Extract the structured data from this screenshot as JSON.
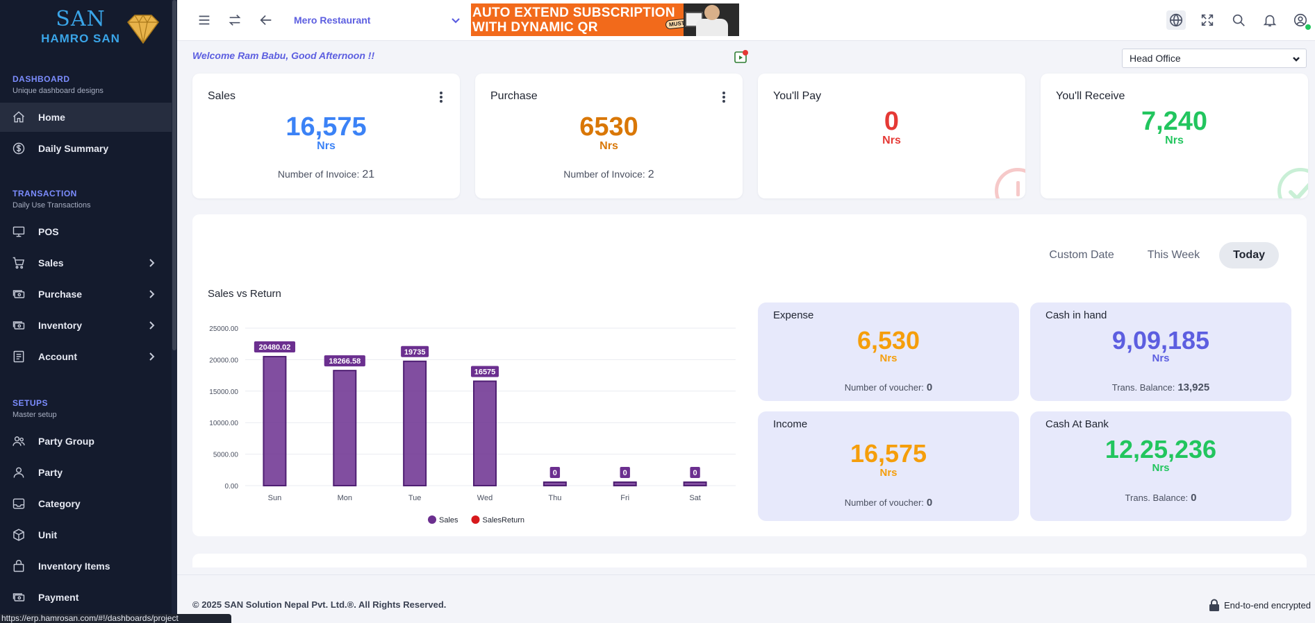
{
  "brand": {
    "logo_top": "SAN",
    "logo_bottom": "HAMRO SAN"
  },
  "sidebar": {
    "sections": [
      {
        "title": "DASHBOARD",
        "subtitle": "Unique dashboard designs"
      },
      {
        "title": "TRANSACTION",
        "subtitle": "Daily Use Transactions"
      },
      {
        "title": "SETUPS",
        "subtitle": "Master setup"
      }
    ],
    "items": [
      {
        "label": "Home",
        "icon": "home-icon",
        "active": true
      },
      {
        "label": "Daily Summary",
        "icon": "dollar-circle-icon"
      },
      {
        "label": "POS",
        "icon": "monitor-icon"
      },
      {
        "label": "Sales",
        "icon": "cart-icon",
        "expandable": true
      },
      {
        "label": "Purchase",
        "icon": "cash-icon",
        "expandable": true
      },
      {
        "label": "Inventory",
        "icon": "cash-icon",
        "expandable": true
      },
      {
        "label": "Account",
        "icon": "ledger-icon",
        "expandable": true
      },
      {
        "label": "Party Group",
        "icon": "users-icon"
      },
      {
        "label": "Party",
        "icon": "user-icon"
      },
      {
        "label": "Category",
        "icon": "inbox-icon"
      },
      {
        "label": "Unit",
        "icon": "cube-icon"
      },
      {
        "label": "Inventory Items",
        "icon": "bag-icon"
      },
      {
        "label": "Payment",
        "icon": "cash-icon"
      }
    ]
  },
  "topbar": {
    "restaurant": "Mero Restaurant",
    "banner_line1": "AUTO EXTEND SUBSCRIPTION",
    "banner_line2": "WITH DYNAMIC QR",
    "banner_badge": "MUST TRY",
    "icons": [
      "menu-icon",
      "swap-icon",
      "back-arrow-icon",
      "globe-icon",
      "fullscreen-icon",
      "search-icon",
      "bell-icon",
      "user-circle-icon"
    ]
  },
  "welcome": "Welcome Ram Babu, Good Afternoon !!",
  "branch": {
    "selected": "Head Office"
  },
  "cards": [
    {
      "title": "Sales",
      "amount": "16,575",
      "unit": "Nrs",
      "meta_label": "Number of Invoice:",
      "meta_value": "21",
      "color": "#3b82f6"
    },
    {
      "title": "Purchase",
      "amount": "6530",
      "unit": "Nrs",
      "meta_label": "Number of Invoice:",
      "meta_value": "2",
      "color": "#d97706"
    },
    {
      "title": "You'll Pay",
      "amount": "0",
      "unit": "Nrs",
      "color": "#e53935"
    },
    {
      "title": "You'll Receive",
      "amount": "7,240",
      "unit": "Nrs",
      "color": "#22c55e"
    }
  ],
  "date_tabs": [
    {
      "label": "Custom Date",
      "active": false
    },
    {
      "label": "This Week",
      "active": false
    },
    {
      "label": "Today",
      "active": true
    }
  ],
  "chart_data": {
    "type": "bar",
    "title": "Sales vs Return",
    "categories": [
      "Sun",
      "Mon",
      "Tue",
      "Wed",
      "Thu",
      "Fri",
      "Sat"
    ],
    "series": [
      {
        "name": "Sales",
        "color": "#6b2f8f",
        "values": [
          20480.02,
          18266.58,
          19735,
          16575,
          0,
          0,
          0
        ]
      },
      {
        "name": "SalesReturn",
        "color": "#d7191c",
        "values": [
          0,
          0,
          0,
          0,
          0,
          0,
          0
        ]
      }
    ],
    "data_labels": [
      "20480.02",
      "18266.58",
      "19735",
      "16575",
      "0",
      "0",
      "0"
    ],
    "y_ticks": [
      "25000.00",
      "20000.00",
      "15000.00",
      "10000.00",
      "5000.00",
      "0.00"
    ],
    "ylim": [
      0,
      25000
    ],
    "legend_position": "bottom"
  },
  "mini_cards": [
    {
      "title": "Expense",
      "amount": "6,530",
      "unit": "Nrs",
      "meta_label": "Number of voucher:",
      "meta_value": "0",
      "color": "#f59e0b"
    },
    {
      "title": "Cash in hand",
      "amount": "9,09,185",
      "unit": "Nrs",
      "meta_label": "Trans. Balance:",
      "meta_value": "13,925",
      "color": "#5c5ee0"
    },
    {
      "title": "Income",
      "amount": "16,575",
      "unit": "Nrs",
      "meta_label": "Number of voucher:",
      "meta_value": "0",
      "color": "#f59e0b"
    },
    {
      "title": "Cash At Bank",
      "amount": "12,25,236",
      "unit": "Nrs",
      "meta_label": "Trans. Balance:",
      "meta_value": "0",
      "color": "#22c55e"
    }
  ],
  "footer": {
    "copyright": "© 2025   SAN Solution Nepal Pvt. Ltd.®. All Rights Reserved.",
    "encrypted": "End-to-end encrypted"
  },
  "status_url": "https://erp.hamrosan.com/#!/dashboards/project"
}
